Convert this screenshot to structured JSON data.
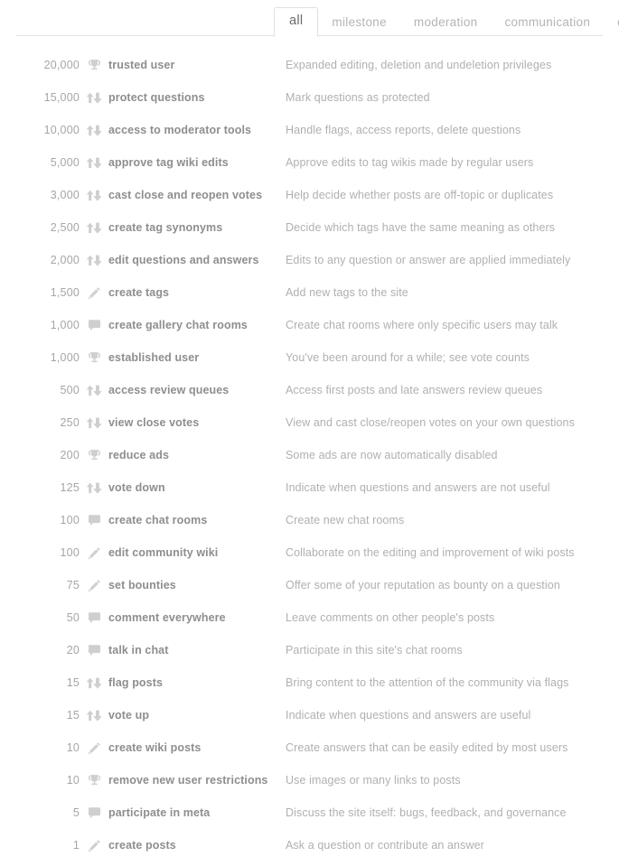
{
  "tabs": [
    {
      "label": "all",
      "active": true
    },
    {
      "label": "milestone",
      "active": false
    },
    {
      "label": "moderation",
      "active": false
    },
    {
      "label": "communication",
      "active": false
    },
    {
      "label": "creation",
      "active": false
    }
  ],
  "colors": {
    "rule": "#e4e4e4",
    "active_tab_border": "#e0e0e0",
    "icon": "#cfcfcf",
    "name_text": "#8e8e8e",
    "desc_text": "#b0b0b0",
    "rep_text": "#a6a6a6"
  },
  "privileges": [
    {
      "rep": "20,000",
      "icon": "trophy-icon",
      "name": "trusted user",
      "desc": "Expanded editing, deletion and undeletion privileges"
    },
    {
      "rep": "15,000",
      "icon": "vote-arrows-icon",
      "name": "protect questions",
      "desc": "Mark questions as protected"
    },
    {
      "rep": "10,000",
      "icon": "vote-arrows-icon",
      "name": "access to moderator tools",
      "desc": "Handle flags, access reports, delete questions"
    },
    {
      "rep": "5,000",
      "icon": "vote-arrows-icon",
      "name": "approve tag wiki edits",
      "desc": "Approve edits to tag wikis made by regular users"
    },
    {
      "rep": "3,000",
      "icon": "vote-arrows-icon",
      "name": "cast close and reopen votes",
      "desc": "Help decide whether posts are off-topic or duplicates"
    },
    {
      "rep": "2,500",
      "icon": "vote-arrows-icon",
      "name": "create tag synonyms",
      "desc": "Decide which tags have the same meaning as others"
    },
    {
      "rep": "2,000",
      "icon": "vote-arrows-icon",
      "name": "edit questions and answers",
      "desc": "Edits to any question or answer are applied immediately"
    },
    {
      "rep": "1,500",
      "icon": "pencil-icon",
      "name": "create tags",
      "desc": "Add new tags to the site"
    },
    {
      "rep": "1,000",
      "icon": "speech-bubble-icon",
      "name": "create gallery chat rooms",
      "desc": "Create chat rooms where only specific users may talk"
    },
    {
      "rep": "1,000",
      "icon": "trophy-icon",
      "name": "established user",
      "desc": "You've been around for a while; see vote counts"
    },
    {
      "rep": "500",
      "icon": "vote-arrows-icon",
      "name": "access review queues",
      "desc": "Access first posts and late answers review queues"
    },
    {
      "rep": "250",
      "icon": "vote-arrows-icon",
      "name": "view close votes",
      "desc": "View and cast close/reopen votes on your own questions"
    },
    {
      "rep": "200",
      "icon": "trophy-icon",
      "name": "reduce ads",
      "desc": "Some ads are now automatically disabled"
    },
    {
      "rep": "125",
      "icon": "vote-arrows-icon",
      "name": "vote down",
      "desc": "Indicate when questions and answers are not useful"
    },
    {
      "rep": "100",
      "icon": "speech-bubble-icon",
      "name": "create chat rooms",
      "desc": "Create new chat rooms"
    },
    {
      "rep": "100",
      "icon": "pencil-icon",
      "name": "edit community wiki",
      "desc": "Collaborate on the editing and improvement of wiki posts"
    },
    {
      "rep": "75",
      "icon": "pencil-icon",
      "name": "set bounties",
      "desc": "Offer some of your reputation as bounty on a question"
    },
    {
      "rep": "50",
      "icon": "speech-bubble-icon",
      "name": "comment everywhere",
      "desc": "Leave comments on other people's posts"
    },
    {
      "rep": "20",
      "icon": "speech-bubble-icon",
      "name": "talk in chat",
      "desc": "Participate in this site's chat rooms"
    },
    {
      "rep": "15",
      "icon": "vote-arrows-icon",
      "name": "flag posts",
      "desc": "Bring content to the attention of the community via flags"
    },
    {
      "rep": "15",
      "icon": "vote-arrows-icon",
      "name": "vote up",
      "desc": "Indicate when questions and answers are useful"
    },
    {
      "rep": "10",
      "icon": "pencil-icon",
      "name": "create wiki posts",
      "desc": "Create answers that can be easily edited by most users"
    },
    {
      "rep": "10",
      "icon": "trophy-icon",
      "name": "remove new user restrictions",
      "desc": "Use images or many links to posts"
    },
    {
      "rep": "5",
      "icon": "speech-bubble-icon",
      "name": "participate in meta",
      "desc": "Discuss the site itself: bugs, feedback, and governance"
    },
    {
      "rep": "1",
      "icon": "pencil-icon",
      "name": "create posts",
      "desc": "Ask a question or contribute an answer"
    }
  ]
}
